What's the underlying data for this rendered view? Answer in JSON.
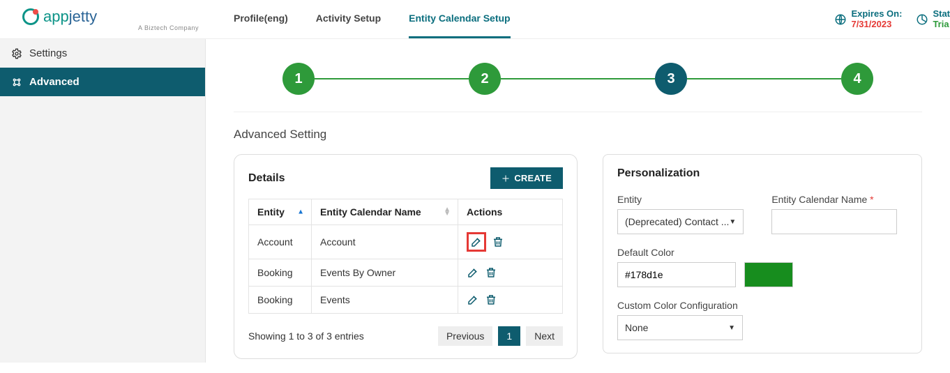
{
  "logo": {
    "brand_a": "app",
    "brand_b": "jetty",
    "tagline": "A Biztech Company"
  },
  "tabs": [
    {
      "label": "Profile(eng)"
    },
    {
      "label": "Activity Setup"
    },
    {
      "label": "Entity Calendar Setup"
    }
  ],
  "header_right": {
    "expires_label": "Expires On:",
    "expires_value": "7/31/2023",
    "status_label": "Stat",
    "status_value": "Tria"
  },
  "sidebar": {
    "items": [
      {
        "label": "Settings"
      },
      {
        "label": "Advanced"
      }
    ]
  },
  "stepper": {
    "steps": [
      "1",
      "2",
      "3",
      "4"
    ]
  },
  "section_title": "Advanced Setting",
  "details": {
    "title": "Details",
    "create_label": "CREATE",
    "columns": {
      "entity": "Entity",
      "calname": "Entity Calendar Name",
      "actions": "Actions"
    },
    "rows": [
      {
        "entity": "Account",
        "calname": "Account"
      },
      {
        "entity": "Booking",
        "calname": "Events By Owner"
      },
      {
        "entity": "Booking",
        "calname": "Events"
      }
    ],
    "showing": "Showing 1 to 3 of 3 entries",
    "pager": {
      "prev": "Previous",
      "page": "1",
      "next": "Next"
    }
  },
  "personalization": {
    "title": "Personalization",
    "entity_label": "Entity",
    "entity_value": "(Deprecated) Contact ...",
    "calname_label": "Entity Calendar Name",
    "calname_value": "",
    "default_color_label": "Default Color",
    "default_color_value": "#178d1e",
    "custom_color_label": "Custom Color Configuration",
    "custom_color_value": "None"
  }
}
